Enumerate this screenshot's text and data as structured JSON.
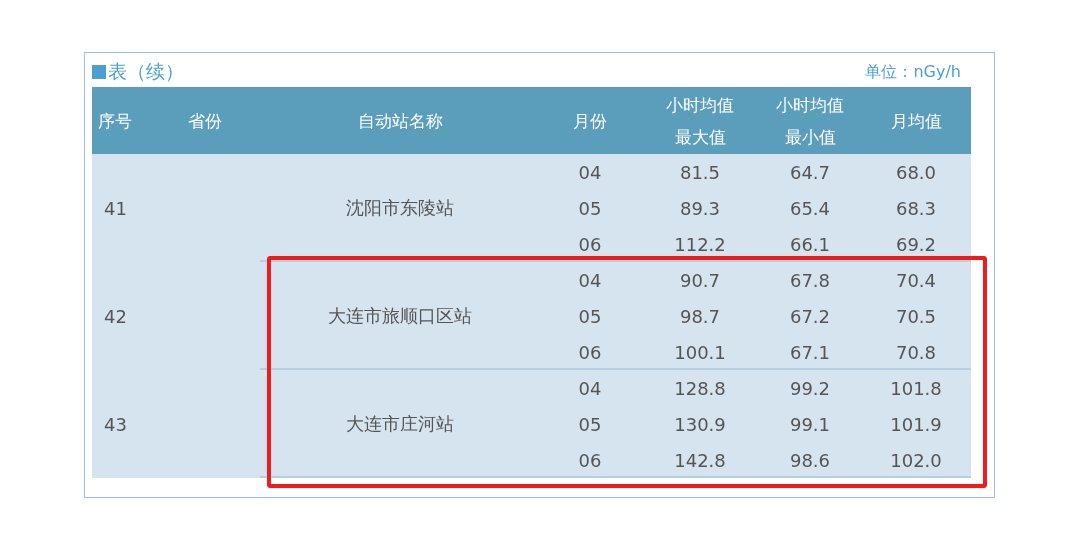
{
  "title": "表（续）",
  "unit": "单位：nGy/h",
  "columns": [
    "序号",
    "省份",
    "自动站名称",
    "月份",
    "小时均值最大值",
    "小时均值最小值",
    "月均值"
  ],
  "stations": [
    {
      "number": "41",
      "name": "沈阳市东陵站",
      "highlighted": false,
      "rows": [
        [
          "04",
          "81.5",
          "64.7",
          "68.0"
        ],
        [
          "05",
          "89.3",
          "65.4",
          "68.3"
        ],
        [
          "06",
          "112.2",
          "66.1",
          "69.2"
        ]
      ]
    },
    {
      "number": "42",
      "name": "大连市旅顺口区站",
      "highlighted": true,
      "rows": [
        [
          "04",
          "90.7",
          "67.8",
          "70.4"
        ],
        [
          "05",
          "98.7",
          "67.2",
          "70.5"
        ],
        [
          "06",
          "100.1",
          "67.1",
          "70.8"
        ]
      ]
    },
    {
      "number": "43",
      "name": "大连市庄河站",
      "highlighted": true,
      "rows": [
        [
          "04",
          "128.8",
          "99.2",
          "101.8"
        ],
        [
          "05",
          "130.9",
          "99.1",
          "101.9"
        ],
        [
          "06",
          "142.8",
          "98.6",
          "102.0"
        ]
      ]
    }
  ]
}
